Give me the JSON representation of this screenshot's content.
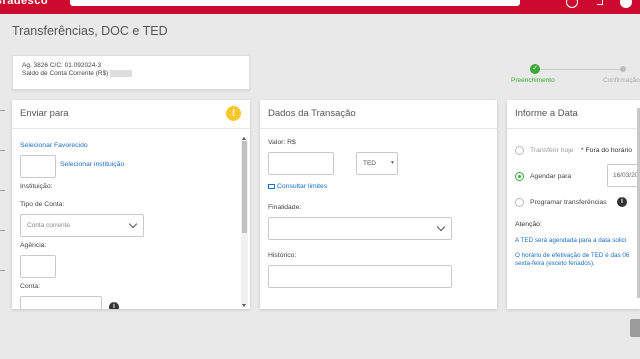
{
  "header": {
    "brand": "Bradesco"
  },
  "page": {
    "title": "Transferências, DOC e TED"
  },
  "account": {
    "line1": "Ag. 3826 C/C: 01.092024-3",
    "line2": "Saldo de Conta Corrente (R$)"
  },
  "stepper": {
    "step1": "Preenchimento",
    "step2": "Confirmação"
  },
  "send_to": {
    "title": "Enviar para",
    "select_favorite": "Selecionar Favorecido",
    "select_institution": "Selecionar instituição",
    "institution_label": "Instituição:",
    "account_type_label": "Tipo de Conta:",
    "account_type_value": "Conta corrente",
    "agency_label": "Agência:",
    "account_label": "Conta:"
  },
  "transaction": {
    "title": "Dados da Transação",
    "value_label": "Valor: R$",
    "type_value": "TED",
    "limits_link": "Consultar limites",
    "purpose_label": "Finalidade:",
    "history_label": "Histórico:"
  },
  "date": {
    "title": "Informe a Data",
    "today_label": "Transferir hoje",
    "off_hours": "* Fora do horário",
    "schedule_label": "Agendar para",
    "schedule_date": "16/03/20",
    "program_label": "Programar transferências",
    "attention_label": "Atenção:",
    "attention_text": "A TED será agendada para a data solici",
    "hours_text_1": "O horário de efetivação de TED é das 06",
    "hours_text_2": "sexta-feira (exceto feriados)."
  },
  "colors": {
    "brand": "#cc092f",
    "success": "#3aa935",
    "link": "#1a6fc4",
    "warning": "#f6c62f"
  }
}
